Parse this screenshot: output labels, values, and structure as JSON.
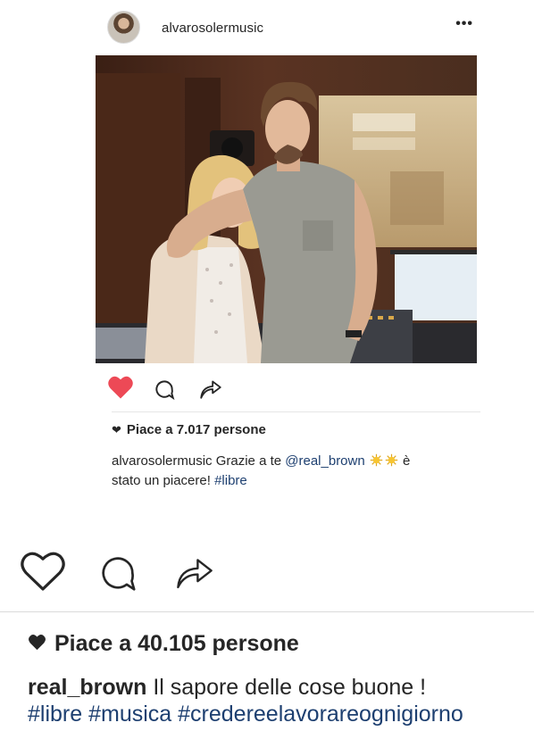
{
  "embedded_post": {
    "username": "alvarosolermusic",
    "more_label": "•••",
    "likes_text": "Piace a 7.017 persone",
    "caption": {
      "username": "alvarosolermusic",
      "text_before": "Grazie a te",
      "mention": "@real_brown",
      "emoji": "sun-icon x2",
      "text_after": "è",
      "text_line2": "stato un piacere!",
      "hashtag": "#libre"
    },
    "like_state": "liked",
    "like_color": "#ed4956"
  },
  "post": {
    "likes_text": "Piace a 40.105 persone",
    "caption": {
      "username": "real_brown",
      "text": "Il sapore delle cose buone !",
      "hashtags": "#libre #musica #credereelavorareognigiorno"
    }
  },
  "colors": {
    "text": "#262626",
    "link": "#1d3f70",
    "divider": "#dbdbdb"
  },
  "icons": [
    "more-icon",
    "heart-icon",
    "comment-icon",
    "share-icon"
  ]
}
